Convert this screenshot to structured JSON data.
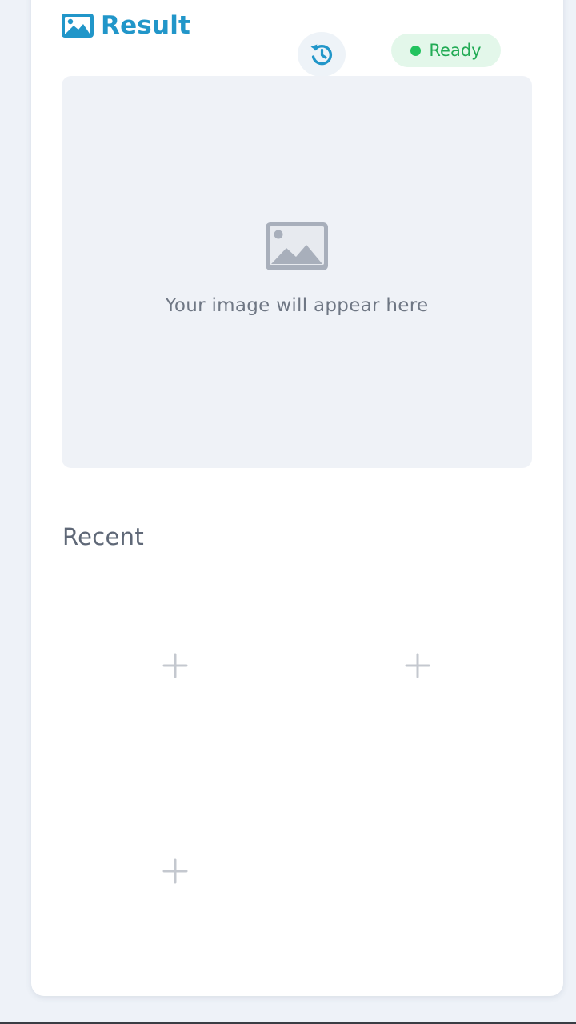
{
  "header": {
    "title": "Result",
    "title_icon": "image-icon",
    "history_icon": "history-icon",
    "status": {
      "label": "Ready",
      "color": "#22c35e"
    }
  },
  "preview": {
    "icon": "image-placeholder-icon",
    "placeholder_text": "Your image will appear here"
  },
  "recent": {
    "heading": "Recent",
    "slots": [
      {
        "icon": "plus-icon"
      },
      {
        "icon": "plus-icon"
      },
      {
        "icon": "plus-icon"
      }
    ]
  },
  "colors": {
    "accent": "#2196c9",
    "page_background": "#eef2f8",
    "card_background": "#ffffff"
  }
}
